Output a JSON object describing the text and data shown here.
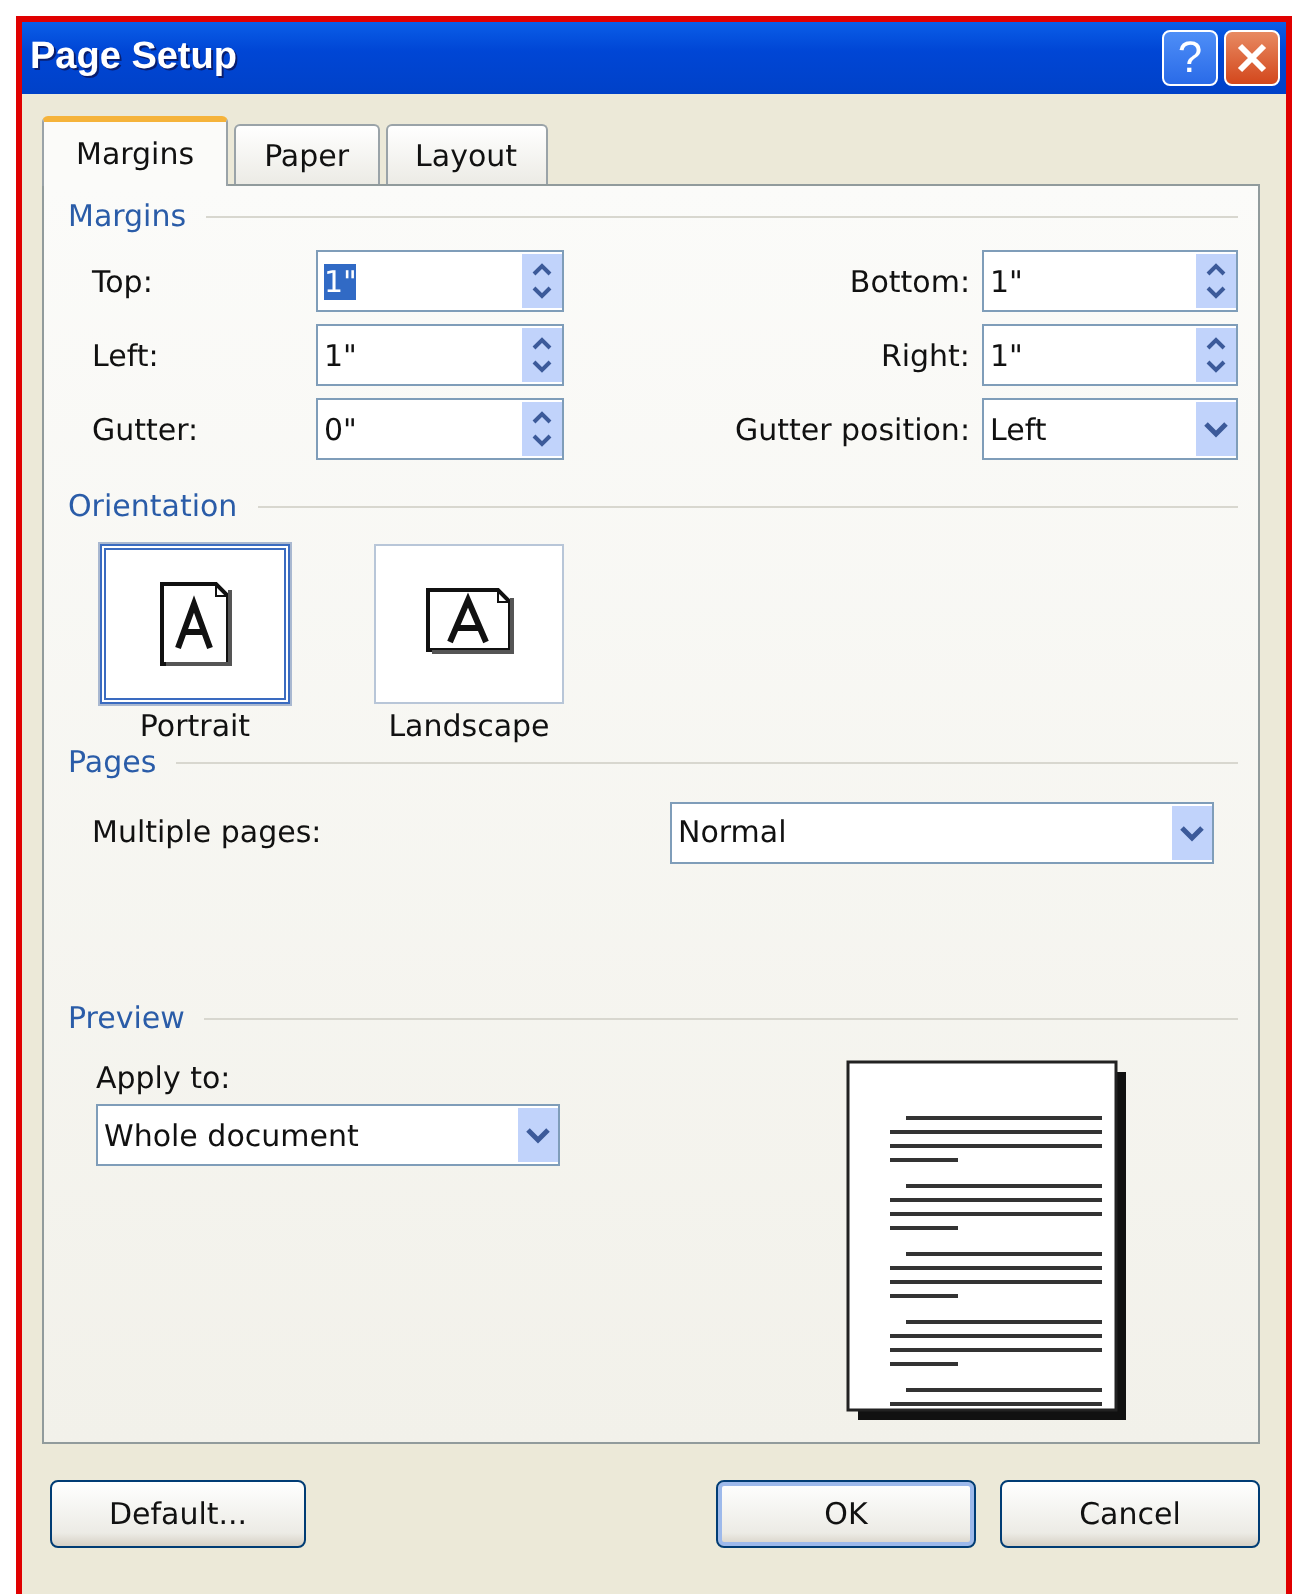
{
  "window": {
    "title": "Page Setup",
    "help_button": "?"
  },
  "tabs": [
    {
      "label": "Margins",
      "selected": true
    },
    {
      "label": "Paper",
      "selected": false
    },
    {
      "label": "Layout",
      "selected": false
    }
  ],
  "margins": {
    "heading": "Margins",
    "fields": [
      {
        "label": "Top:",
        "value": "1\"",
        "kind": "spin",
        "selected": true
      },
      {
        "label": "Bottom:",
        "value": "1\"",
        "kind": "spin",
        "selected": false
      },
      {
        "label": "Left:",
        "value": "1\"",
        "kind": "spin",
        "selected": false
      },
      {
        "label": "Right:",
        "value": "1\"",
        "kind": "spin",
        "selected": false
      },
      {
        "label": "Gutter:",
        "value": "0\"",
        "kind": "spin",
        "selected": false
      },
      {
        "label": "Gutter position:",
        "value": "Left",
        "kind": "dropdown",
        "selected": false
      }
    ]
  },
  "orientation": {
    "heading": "Orientation",
    "options": [
      {
        "label": "Portrait",
        "kind": "portrait",
        "selected": true
      },
      {
        "label": "Landscape",
        "kind": "landscape",
        "selected": false
      }
    ]
  },
  "pages": {
    "heading": "Pages",
    "multiple_pages": {
      "label": "Multiple pages:",
      "value": "Normal"
    }
  },
  "preview": {
    "heading": "Preview",
    "apply_to": {
      "label": "Apply to:",
      "value": "Whole document"
    }
  },
  "buttons": [
    {
      "label": "Default...",
      "kind": "left",
      "default": false
    },
    {
      "label": "OK",
      "kind": "right",
      "default": true
    },
    {
      "label": "Cancel",
      "kind": "right",
      "default": false
    }
  ]
}
